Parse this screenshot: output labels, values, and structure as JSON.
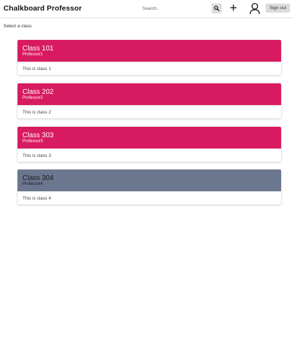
{
  "header": {
    "brand": "Chalkboard Professor",
    "search_placeholder": "Search..",
    "search_icon": "search-icon",
    "add_icon": "plus-icon",
    "user_icon": "user-icon",
    "signout_label": "Sign out"
  },
  "page": {
    "select_label": "Select a class"
  },
  "classes": [
    {
      "title": "Class 101",
      "professor": "Professor1",
      "description": "This is class 1",
      "color": "#d81b60",
      "text_color": "#ffffff"
    },
    {
      "title": "Class 202",
      "professor": "Professor2",
      "description": "This is class 2",
      "color": "#d81b60",
      "text_color": "#ffffff"
    },
    {
      "title": "Class 303",
      "professor": "Professor3",
      "description": "This is class 3",
      "color": "#d81b60",
      "text_color": "#ffffff"
    },
    {
      "title": "Class 304",
      "professor": "Professor4",
      "description": "This is class 4",
      "color": "#6b768f",
      "text_color": "#1a1a1a"
    }
  ]
}
